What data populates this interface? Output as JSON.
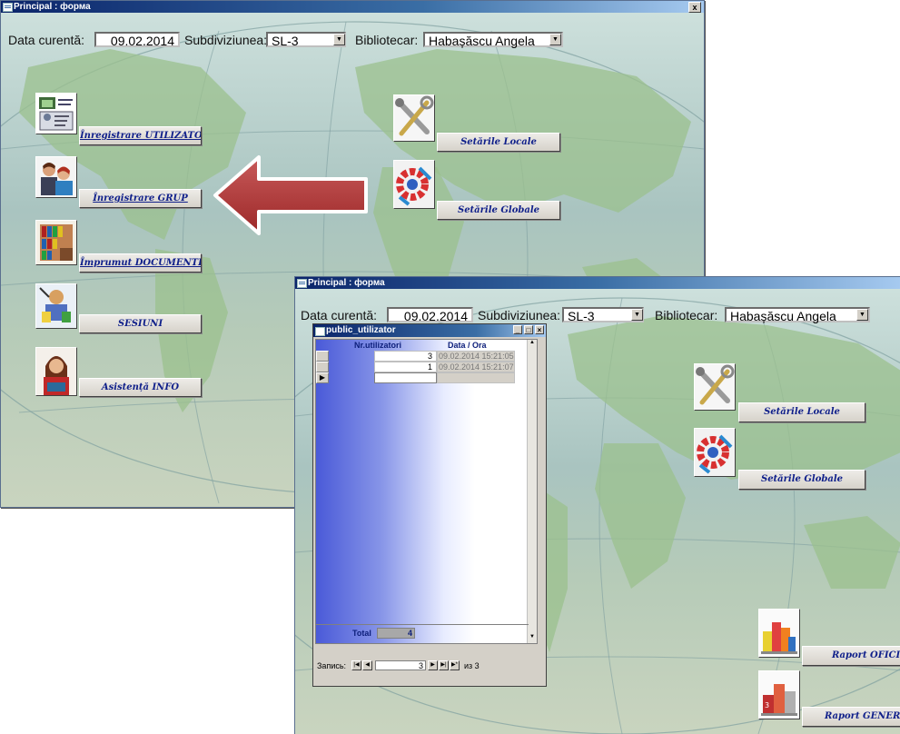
{
  "back_window": {
    "title": "Principal : форма",
    "header": {
      "date_label": "Data curentă:",
      "date_value": "09.02.2014",
      "subdiv_label": "Subdiviziunea:",
      "subdiv_value": "SL-3",
      "biblio_label": "Bibliotecar:",
      "biblio_value": "Habașăscu Angela"
    },
    "buttons": {
      "user_reg": "Înregistrare UTILIZATOR",
      "group_reg": "Înregistrare GRUP",
      "loan": "Împrumut DOCUMENTE",
      "sessions": "SESIUNI",
      "assist": "Asistență INFO",
      "local_settings": "Setările Locale",
      "global_settings": "Setările Globale"
    },
    "close_glyph": "x"
  },
  "front_window": {
    "title": "Principal : форма",
    "header": {
      "date_label": "Data curentă:",
      "date_value": "09.02.2014",
      "subdiv_label": "Subdiviziunea:",
      "subdiv_value": "SL-3",
      "biblio_label": "Bibliotecar:",
      "biblio_value": "Habașăscu Angela"
    },
    "buttons": {
      "local_settings": "Setările Locale",
      "global_settings": "Setările Globale",
      "report_office": "Raport OFICIU",
      "report_general": "Raport GENERAL"
    }
  },
  "subform": {
    "title": "public_utilizator",
    "col_users": "Nr.utilizatori",
    "col_date": "Data / Ora",
    "rows": [
      {
        "users": "3",
        "date": "09.02.2014 15:21:05"
      },
      {
        "users": "1",
        "date": "09.02.2014 15:21:07"
      }
    ],
    "total_label": "Total",
    "total_value": "4",
    "nav_label": "Запись:",
    "nav_current": "3",
    "nav_of": "из 3"
  },
  "colors": {
    "title_bar": "#0a246a",
    "button_text": "#0f1f8a",
    "arrow": "#b33a3a"
  }
}
